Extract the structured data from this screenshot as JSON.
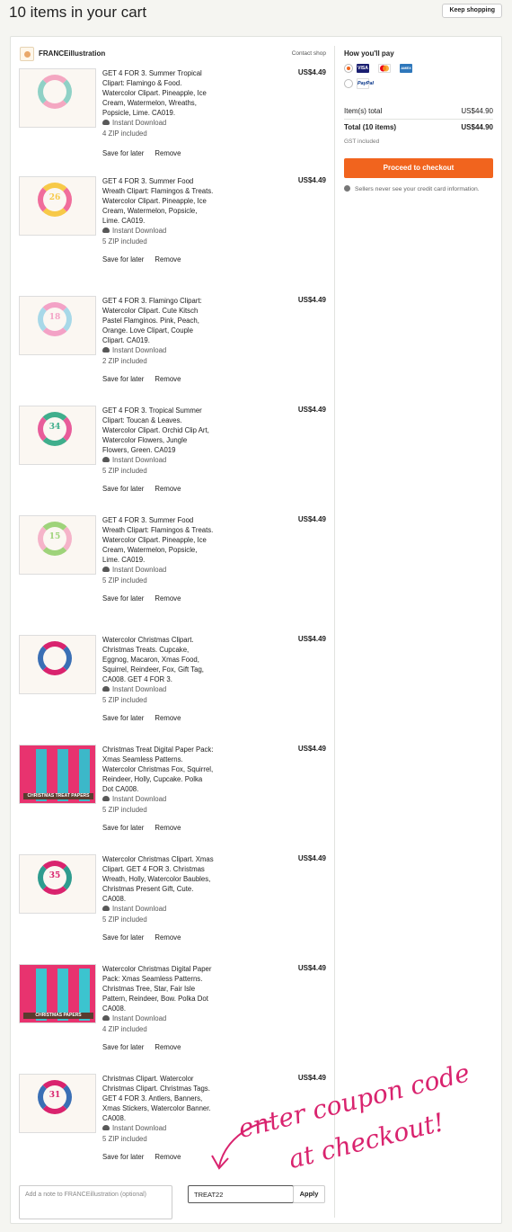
{
  "page": {
    "title": "10 items in your cart",
    "keep_shopping": "Keep shopping"
  },
  "shop": {
    "name": "FRANCEillustration",
    "contact": "Contact shop"
  },
  "items": [
    {
      "desc": "GET 4 FOR 3. Summer Tropical Clipart: Flamingo & Food. Watercolor Clipart. Pineapple, Ice Cream, Watermelon, Wreaths, Popsicle, Lime. CA019.",
      "price": "US$4.49",
      "download": "Instant Download",
      "zip": "4 ZIP included",
      "thumb_num": "",
      "thumb_bar": "",
      "c1": "#f4a7c1",
      "c2": "#8fd1c6"
    },
    {
      "desc": "GET 4 FOR 3. Summer Food Wreath Clipart: Flamingos & Treats. Watercolor Clipart. Pineapple, Ice Cream, Watermelon, Popsicle, Lime. CA019.",
      "price": "US$4.49",
      "download": "Instant Download",
      "zip": "5 ZIP included",
      "thumb_num": "26",
      "thumb_bar": "",
      "c1": "#f7c948",
      "c2": "#f06d9b"
    },
    {
      "desc": "GET 4 FOR 3. Flamingo Clipart: Watercolor Clipart. Cute Kitsch Pastel Flamginos. Pink, Peach, Orange. Love Clipart, Couple Clipart. CA019.",
      "price": "US$4.49",
      "download": "Instant Download",
      "zip": "2 ZIP included",
      "thumb_num": "18",
      "thumb_bar": "",
      "c1": "#f3a2c6",
      "c2": "#a7d8e8"
    },
    {
      "desc": "GET 4 FOR 3. Tropical Summer Clipart: Toucan & Leaves. Watercolor Clipart. Orchid Clip Art, Watercolor Flowers, Jungle Flowers, Green. CA019",
      "price": "US$4.49",
      "download": "Instant Download",
      "zip": "5 ZIP included",
      "thumb_num": "34",
      "thumb_bar": "",
      "c1": "#3fae8c",
      "c2": "#e85c9a"
    },
    {
      "desc": "GET 4 FOR 3. Summer Food Wreath Clipart: Flamingos & Treats. Watercolor Clipart. Pineapple, Ice Cream, Watermelon, Popsicle, Lime. CA019.",
      "price": "US$4.49",
      "download": "Instant Download",
      "zip": "5 ZIP included",
      "thumb_num": "15",
      "thumb_bar": "",
      "c1": "#9ed37a",
      "c2": "#f5b3c9"
    },
    {
      "desc": "Watercolor Christmas Clipart. Christmas Treats. Cupcake, Eggnog, Macaron, Xmas Food, Squirrel, Reindeer, Fox, Gift Tag, CA008. GET 4 FOR 3.",
      "price": "US$4.49",
      "download": "Instant Download",
      "zip": "5 ZIP included",
      "thumb_num": "",
      "thumb_bar": "",
      "c1": "#d9236e",
      "c2": "#3a6fb5"
    },
    {
      "desc": "Christmas Treat Digital Paper Pack: Xmas Seamless Patterns. Watercolor Christmas Fox, Squirrel, Reindeer, Holly, Cupcake. Polka Dot CA008.",
      "price": "US$4.49",
      "download": "Instant Download",
      "zip": "5 ZIP included",
      "thumb_num": "",
      "thumb_bar": "CHRISTMAS TREAT PAPERS",
      "c1": "#e8336f",
      "c2": "#3cb8c9"
    },
    {
      "desc": "Watercolor Christmas Clipart. Xmas Clipart. GET 4 FOR 3. Christmas Wreath, Holly, Watercolor Baubles, Christmas Present Gift, Cute. CA008.",
      "price": "US$4.49",
      "download": "Instant Download",
      "zip": "5 ZIP included",
      "thumb_num": "35",
      "thumb_bar": "",
      "c1": "#d9236e",
      "c2": "#2e9c8f"
    },
    {
      "desc": "Watercolor Christmas Digital Paper Pack: Xmas Seamless Patterns. Christmas Tree, Star, Fair Isle Pattern, Reindeer, Bow. Polka Dot CA008.",
      "price": "US$4.49",
      "download": "Instant Download",
      "zip": "4 ZIP included",
      "thumb_num": "",
      "thumb_bar": "CHRISTMAS PAPERS",
      "c1": "#e8336f",
      "c2": "#3cc4cf"
    },
    {
      "desc": "Christmas Clipart. Watercolor Christmas Clipart. Christmas Tags. GET 4 FOR 3. Antlers, Banners, Xmas Stickers, Watercolor Banner. CA008.",
      "price": "US$4.49",
      "download": "Instant Download",
      "zip": "5 ZIP included",
      "thumb_num": "31",
      "thumb_bar": "",
      "c1": "#d9236e",
      "c2": "#3a6fb5"
    }
  ],
  "actions": {
    "save_for_later": "Save for later",
    "remove": "Remove"
  },
  "note": {
    "placeholder": "Add a note to FRANCEillustration (optional)"
  },
  "coupon": {
    "value": "TREAT22",
    "apply": "Apply"
  },
  "annotation": {
    "line1": "enter coupon code",
    "line2": "at checkout!",
    "color": "#d9236e"
  },
  "summary": {
    "how_pay": "How you'll pay",
    "items_total_label": "Item(s) total",
    "items_total_value": "US$44.90",
    "total_label": "Total (10 items)",
    "total_value": "US$44.90",
    "gst": "GST included",
    "checkout": "Proceed to checkout",
    "secure": "Sellers never see your credit card information.",
    "cards": [
      "VISA",
      "MC",
      "AMEX"
    ],
    "paypal": "PayPal",
    "accent": "#f1641e"
  }
}
